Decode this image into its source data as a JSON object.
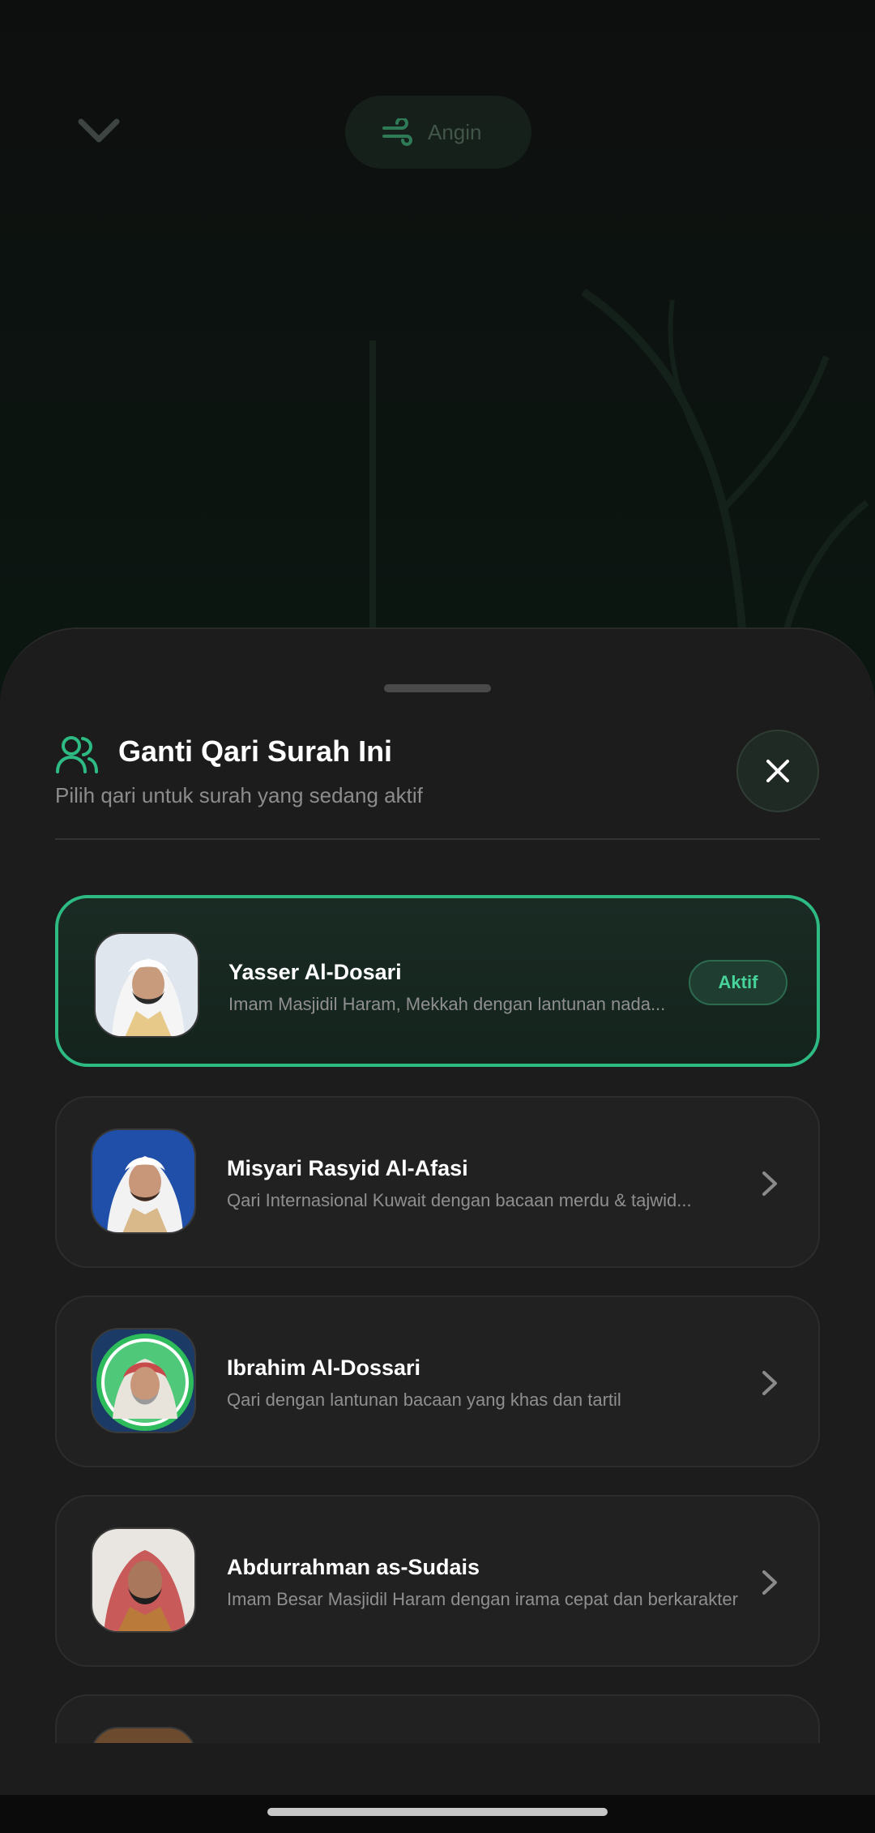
{
  "background": {
    "chip_label": "Angin"
  },
  "sheet": {
    "title": "Ganti Qari Surah Ini",
    "subtitle": "Pilih qari untuk surah yang sedang aktif"
  },
  "reciters": [
    {
      "name": "Yasser Al-Dosari",
      "description": "Imam Masjidil Haram, Mekkah dengan lantunan nada...",
      "status": "Aktif",
      "active": true
    },
    {
      "name": "Misyari Rasyid Al-Afasi",
      "description": "Qari Internasional Kuwait dengan bacaan merdu & tajwid...",
      "active": false
    },
    {
      "name": "Ibrahim Al-Dossari",
      "description": "Qari dengan lantunan bacaan yang khas dan tartil",
      "active": false
    },
    {
      "name": "Abdurrahman as-Sudais",
      "description": "Imam Besar Masjidil Haram dengan irama cepat dan berkarakter",
      "active": false
    }
  ],
  "colors": {
    "accent": "#2dbb83",
    "sheet_bg": "#1c1c1c",
    "card_bg": "#212121"
  }
}
